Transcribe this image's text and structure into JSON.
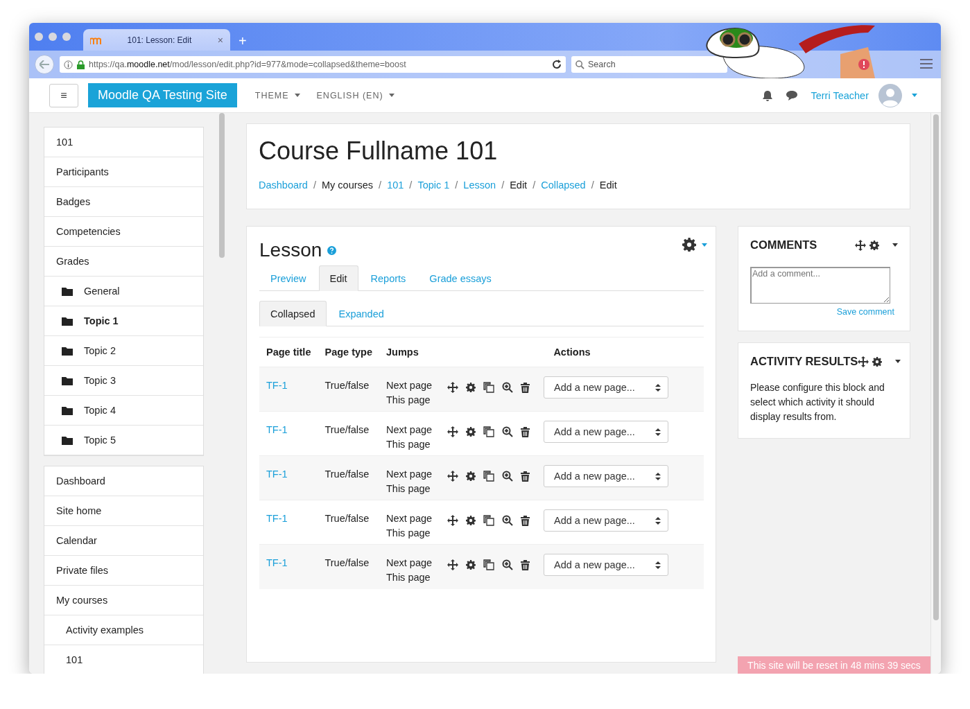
{
  "browser": {
    "tab_title": "101: Lesson: Edit",
    "tab_close": "×",
    "new_tab": "+",
    "url_parts": [
      {
        "text": "https://qa.",
        "kind": "dim"
      },
      {
        "text": "moodle.net",
        "kind": "host"
      },
      {
        "text": "/mod/lesson/edit.php?id=977&mode=collapsed&theme=boost",
        "kind": "dim"
      }
    ],
    "search_placeholder": "Search"
  },
  "navbar": {
    "menu_button": "≡",
    "site_name": "Moodle QA Testing Site",
    "menus": [
      "THEME",
      "ENGLISH (EN)"
    ],
    "user_name": "Terri Teacher"
  },
  "drawer": {
    "sections": [
      {
        "items": [
          {
            "label": "101",
            "kind": "link",
            "selected": false
          },
          {
            "label": "Participants",
            "kind": "link",
            "selected": false
          },
          {
            "label": "Badges",
            "kind": "link",
            "selected": false
          },
          {
            "label": "Competencies",
            "kind": "link",
            "selected": false
          },
          {
            "label": "Grades",
            "kind": "link",
            "selected": false
          },
          {
            "label": "General",
            "kind": "folder",
            "selected": false
          },
          {
            "label": "Topic 1",
            "kind": "folder",
            "selected": true
          },
          {
            "label": "Topic 2",
            "kind": "folder",
            "selected": false
          },
          {
            "label": "Topic 3",
            "kind": "folder",
            "selected": false
          },
          {
            "label": "Topic 4",
            "kind": "folder",
            "selected": false
          },
          {
            "label": "Topic 5",
            "kind": "folder",
            "selected": false
          }
        ]
      },
      {
        "items": [
          {
            "label": "Dashboard",
            "kind": "link",
            "selected": false
          },
          {
            "label": "Site home",
            "kind": "link",
            "selected": false
          },
          {
            "label": "Calendar",
            "kind": "link",
            "selected": false
          },
          {
            "label": "Private files",
            "kind": "link",
            "selected": false
          },
          {
            "label": "My courses",
            "kind": "link",
            "selected": false,
            "children": [
              {
                "label": "Activity examples",
                "selected": false
              },
              {
                "label": "101",
                "selected": false
              }
            ]
          }
        ]
      }
    ]
  },
  "header": {
    "title": "Course Fullname 101",
    "separator": "/",
    "breadcrumb": [
      {
        "label": "Dashboard",
        "link": true
      },
      {
        "label": "My courses",
        "link": false
      },
      {
        "label": "101",
        "link": true
      },
      {
        "label": "Topic 1",
        "link": true
      },
      {
        "label": "Lesson",
        "link": true
      },
      {
        "label": "Edit",
        "link": false
      },
      {
        "label": "Collapsed",
        "link": true
      },
      {
        "label": "Edit",
        "link": false
      }
    ]
  },
  "lesson": {
    "title": "Lesson",
    "tabs": [
      {
        "label": "Preview",
        "selected": false
      },
      {
        "label": "Edit",
        "selected": true
      },
      {
        "label": "Reports",
        "selected": false
      },
      {
        "label": "Grade essays",
        "selected": false
      }
    ],
    "subtabs": [
      {
        "label": "Collapsed",
        "selected": true
      },
      {
        "label": "Expanded",
        "selected": false
      }
    ],
    "columns": [
      "Page title",
      "Page type",
      "Jumps",
      "Actions"
    ],
    "rows": [
      {
        "title": "TF-1",
        "type": "True/false",
        "jumps": [
          "Next page",
          "This page"
        ],
        "select": "Add a new page..."
      },
      {
        "title": "TF-1",
        "type": "True/false",
        "jumps": [
          "Next page",
          "This page"
        ],
        "select": "Add a new page..."
      },
      {
        "title": "TF-1",
        "type": "True/false",
        "jumps": [
          "Next page",
          "This page"
        ],
        "select": "Add a new page..."
      },
      {
        "title": "TF-1",
        "type": "True/false",
        "jumps": [
          "Next page",
          "This page"
        ],
        "select": "Add a new page..."
      },
      {
        "title": "TF-1",
        "type": "True/false",
        "jumps": [
          "Next page",
          "This page"
        ],
        "select": "Add a new page..."
      }
    ]
  },
  "blocks": [
    {
      "kind": "comments",
      "title": "COMMENTS",
      "placeholder": "Add a comment...",
      "action": "Save comment"
    },
    {
      "kind": "text",
      "title": "ACTIVITY RESULTS",
      "text": "Please configure this block and select which activity it should display results from."
    }
  ],
  "notice": "This site will be reset in 48 mins 39 secs"
}
